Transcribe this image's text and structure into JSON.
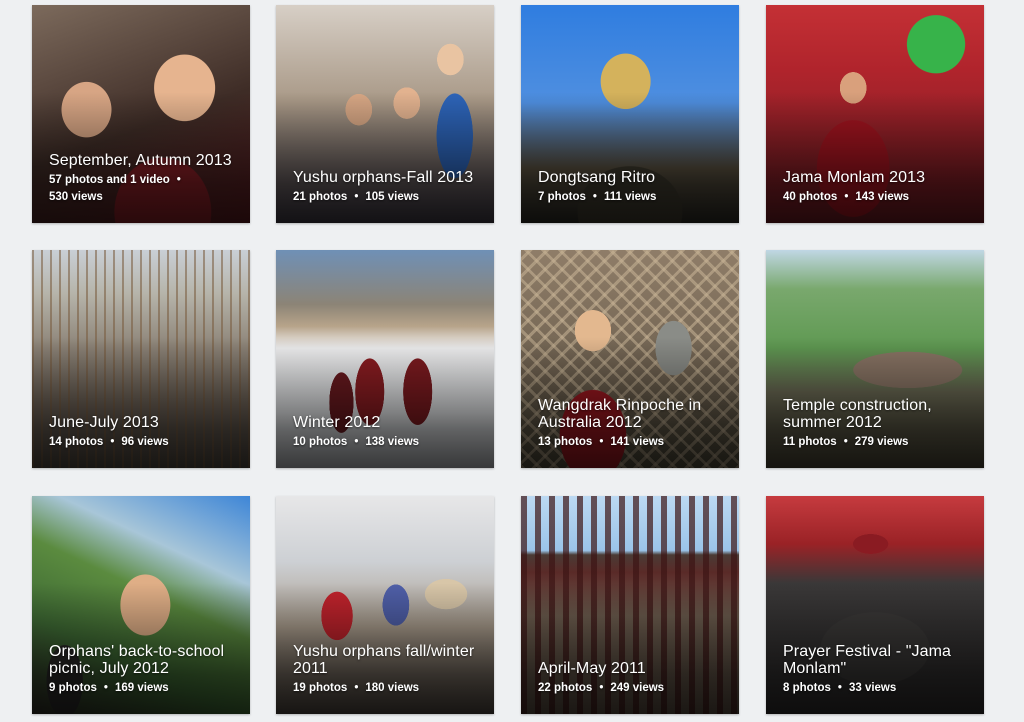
{
  "albums": [
    {
      "title": "September, Autumn 2013",
      "photos": "57 photos and 1 video",
      "views": "530 views"
    },
    {
      "title": "Yushu orphans-Fall 2013",
      "photos": "21 photos",
      "views": "105 views"
    },
    {
      "title": "Dongtsang Ritro",
      "photos": "7 photos",
      "views": "111 views"
    },
    {
      "title": "Jama Monlam 2013",
      "photos": "40 photos",
      "views": "143 views"
    },
    {
      "title": "June-July 2013",
      "photos": "14 photos",
      "views": "96 views"
    },
    {
      "title": "Winter 2012",
      "photos": "10 photos",
      "views": "138 views"
    },
    {
      "title": "Wangdrak Rinpoche in Australia 2012",
      "photos": "13 photos",
      "views": "141 views"
    },
    {
      "title": "Temple construction, summer 2012",
      "photos": "11 photos",
      "views": "279 views"
    },
    {
      "title": "Orphans' back-to-school picnic, July 2012",
      "photos": "9 photos",
      "views": "169 views"
    },
    {
      "title": "Yushu orphans fall/winter 2011",
      "photos": "19 photos",
      "views": "180 views"
    },
    {
      "title": "April-May 2011",
      "photos": "22 photos",
      "views": "249 views"
    },
    {
      "title": "Prayer Festival - \"Jama Monlam\"",
      "photos": "8 photos",
      "views": "33 views"
    }
  ],
  "separator": "•"
}
